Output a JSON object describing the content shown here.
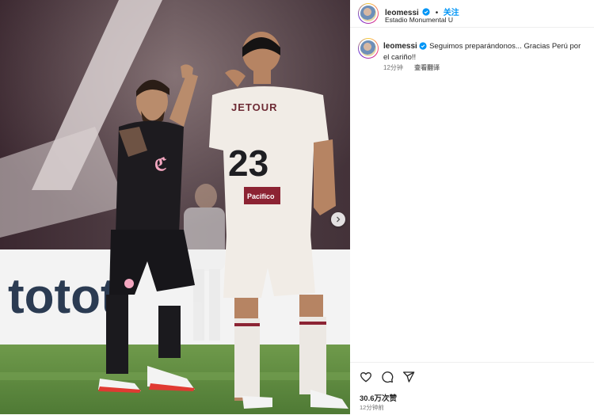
{
  "post": {
    "username": "leomessi",
    "follow_label": "关注",
    "location": "Estadio Monumental U",
    "caption": "Seguimos preparándonos... Gracias Perú por el cariño!!",
    "caption_time": "12分钟",
    "translate_label": "查看翻译",
    "likes": "30.6万次赞",
    "posted_time": "12分钟前"
  },
  "photo": {
    "board_text": "totot",
    "jersey_number": "23",
    "jersey_sponsor": "JETOUR",
    "badge_text": "Pacifico"
  },
  "icons": {
    "like": "heart-icon",
    "comment": "comment-icon",
    "share": "share-icon",
    "next": "chevron-right-icon",
    "verified": "verified-badge-icon"
  },
  "colors": {
    "follow": "#0095f6",
    "verified": "#0095f6",
    "muted": "#737373"
  }
}
